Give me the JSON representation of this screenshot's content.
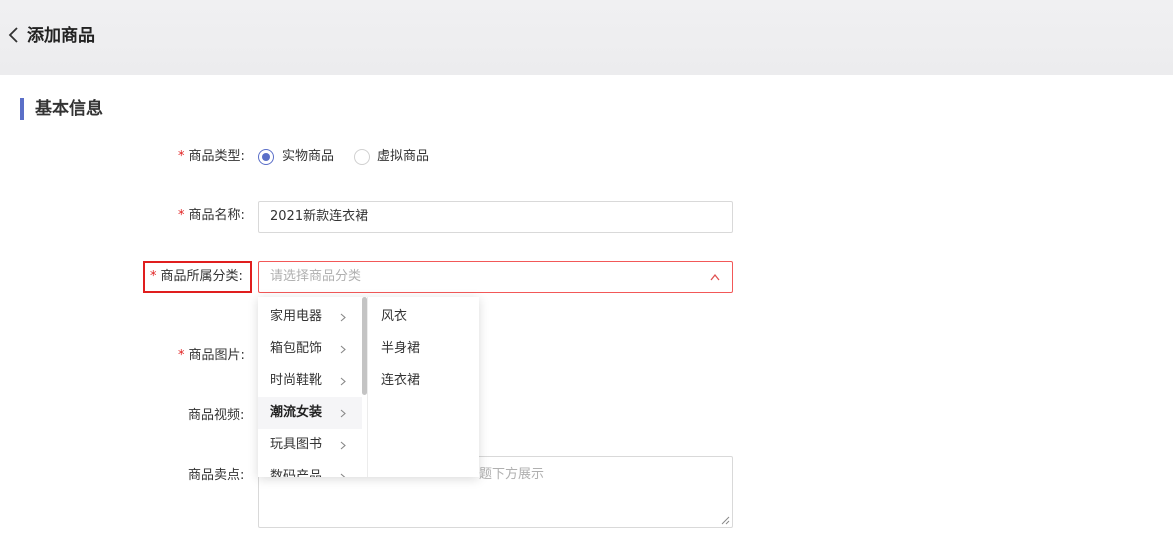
{
  "header": {
    "title": "添加商品"
  },
  "section": {
    "title": "基本信息"
  },
  "form": {
    "type": {
      "required": "*",
      "label": "商品类型:",
      "options": [
        "实物商品",
        "虚拟商品"
      ],
      "selected": "实物商品"
    },
    "name": {
      "required": "*",
      "label": "商品名称:",
      "value": "2021新款连衣裙"
    },
    "category": {
      "required": "*",
      "label": "商品所属分类:",
      "placeholder": "请选择商品分类"
    },
    "image": {
      "required": "*",
      "label": "商品图片:"
    },
    "video": {
      "label": "商品视频:"
    },
    "selling_point": {
      "label": "商品卖点:",
      "placeholder_visible": "题下方展示"
    }
  },
  "dropdown": {
    "level1": [
      "家用电器",
      "箱包配饰",
      "时尚鞋靴",
      "潮流女装",
      "玩具图书",
      "数码产品"
    ],
    "active": "潮流女装",
    "level2": [
      "风衣",
      "半身裙",
      "连衣裙"
    ]
  },
  "colors": {
    "accent": "#5b6fc8",
    "required": "#e02020",
    "highlight": "#e01e1e"
  }
}
